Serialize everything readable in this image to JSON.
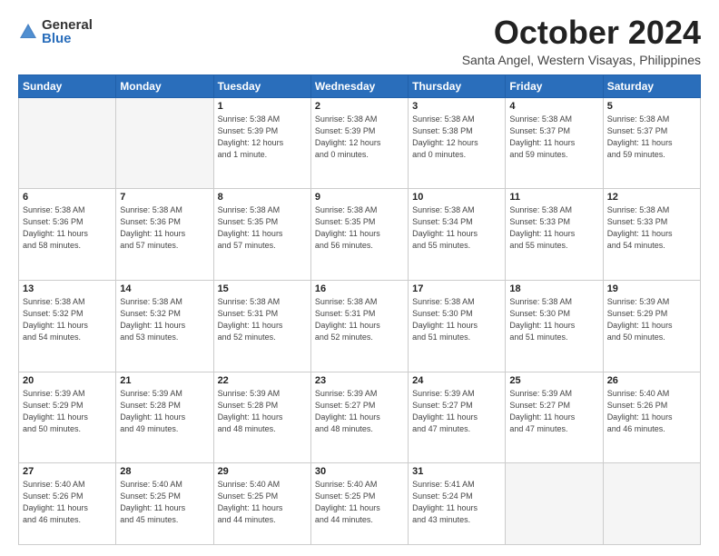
{
  "logo": {
    "general": "General",
    "blue": "Blue"
  },
  "title": "October 2024",
  "location": "Santa Angel, Western Visayas, Philippines",
  "weekdays": [
    "Sunday",
    "Monday",
    "Tuesday",
    "Wednesday",
    "Thursday",
    "Friday",
    "Saturday"
  ],
  "weeks": [
    [
      {
        "day": "",
        "info": ""
      },
      {
        "day": "",
        "info": ""
      },
      {
        "day": "1",
        "info": "Sunrise: 5:38 AM\nSunset: 5:39 PM\nDaylight: 12 hours\nand 1 minute."
      },
      {
        "day": "2",
        "info": "Sunrise: 5:38 AM\nSunset: 5:39 PM\nDaylight: 12 hours\nand 0 minutes."
      },
      {
        "day": "3",
        "info": "Sunrise: 5:38 AM\nSunset: 5:38 PM\nDaylight: 12 hours\nand 0 minutes."
      },
      {
        "day": "4",
        "info": "Sunrise: 5:38 AM\nSunset: 5:37 PM\nDaylight: 11 hours\nand 59 minutes."
      },
      {
        "day": "5",
        "info": "Sunrise: 5:38 AM\nSunset: 5:37 PM\nDaylight: 11 hours\nand 59 minutes."
      }
    ],
    [
      {
        "day": "6",
        "info": "Sunrise: 5:38 AM\nSunset: 5:36 PM\nDaylight: 11 hours\nand 58 minutes."
      },
      {
        "day": "7",
        "info": "Sunrise: 5:38 AM\nSunset: 5:36 PM\nDaylight: 11 hours\nand 57 minutes."
      },
      {
        "day": "8",
        "info": "Sunrise: 5:38 AM\nSunset: 5:35 PM\nDaylight: 11 hours\nand 57 minutes."
      },
      {
        "day": "9",
        "info": "Sunrise: 5:38 AM\nSunset: 5:35 PM\nDaylight: 11 hours\nand 56 minutes."
      },
      {
        "day": "10",
        "info": "Sunrise: 5:38 AM\nSunset: 5:34 PM\nDaylight: 11 hours\nand 55 minutes."
      },
      {
        "day": "11",
        "info": "Sunrise: 5:38 AM\nSunset: 5:33 PM\nDaylight: 11 hours\nand 55 minutes."
      },
      {
        "day": "12",
        "info": "Sunrise: 5:38 AM\nSunset: 5:33 PM\nDaylight: 11 hours\nand 54 minutes."
      }
    ],
    [
      {
        "day": "13",
        "info": "Sunrise: 5:38 AM\nSunset: 5:32 PM\nDaylight: 11 hours\nand 54 minutes."
      },
      {
        "day": "14",
        "info": "Sunrise: 5:38 AM\nSunset: 5:32 PM\nDaylight: 11 hours\nand 53 minutes."
      },
      {
        "day": "15",
        "info": "Sunrise: 5:38 AM\nSunset: 5:31 PM\nDaylight: 11 hours\nand 52 minutes."
      },
      {
        "day": "16",
        "info": "Sunrise: 5:38 AM\nSunset: 5:31 PM\nDaylight: 11 hours\nand 52 minutes."
      },
      {
        "day": "17",
        "info": "Sunrise: 5:38 AM\nSunset: 5:30 PM\nDaylight: 11 hours\nand 51 minutes."
      },
      {
        "day": "18",
        "info": "Sunrise: 5:38 AM\nSunset: 5:30 PM\nDaylight: 11 hours\nand 51 minutes."
      },
      {
        "day": "19",
        "info": "Sunrise: 5:39 AM\nSunset: 5:29 PM\nDaylight: 11 hours\nand 50 minutes."
      }
    ],
    [
      {
        "day": "20",
        "info": "Sunrise: 5:39 AM\nSunset: 5:29 PM\nDaylight: 11 hours\nand 50 minutes."
      },
      {
        "day": "21",
        "info": "Sunrise: 5:39 AM\nSunset: 5:28 PM\nDaylight: 11 hours\nand 49 minutes."
      },
      {
        "day": "22",
        "info": "Sunrise: 5:39 AM\nSunset: 5:28 PM\nDaylight: 11 hours\nand 48 minutes."
      },
      {
        "day": "23",
        "info": "Sunrise: 5:39 AM\nSunset: 5:27 PM\nDaylight: 11 hours\nand 48 minutes."
      },
      {
        "day": "24",
        "info": "Sunrise: 5:39 AM\nSunset: 5:27 PM\nDaylight: 11 hours\nand 47 minutes."
      },
      {
        "day": "25",
        "info": "Sunrise: 5:39 AM\nSunset: 5:27 PM\nDaylight: 11 hours\nand 47 minutes."
      },
      {
        "day": "26",
        "info": "Sunrise: 5:40 AM\nSunset: 5:26 PM\nDaylight: 11 hours\nand 46 minutes."
      }
    ],
    [
      {
        "day": "27",
        "info": "Sunrise: 5:40 AM\nSunset: 5:26 PM\nDaylight: 11 hours\nand 46 minutes."
      },
      {
        "day": "28",
        "info": "Sunrise: 5:40 AM\nSunset: 5:25 PM\nDaylight: 11 hours\nand 45 minutes."
      },
      {
        "day": "29",
        "info": "Sunrise: 5:40 AM\nSunset: 5:25 PM\nDaylight: 11 hours\nand 44 minutes."
      },
      {
        "day": "30",
        "info": "Sunrise: 5:40 AM\nSunset: 5:25 PM\nDaylight: 11 hours\nand 44 minutes."
      },
      {
        "day": "31",
        "info": "Sunrise: 5:41 AM\nSunset: 5:24 PM\nDaylight: 11 hours\nand 43 minutes."
      },
      {
        "day": "",
        "info": ""
      },
      {
        "day": "",
        "info": ""
      }
    ]
  ]
}
